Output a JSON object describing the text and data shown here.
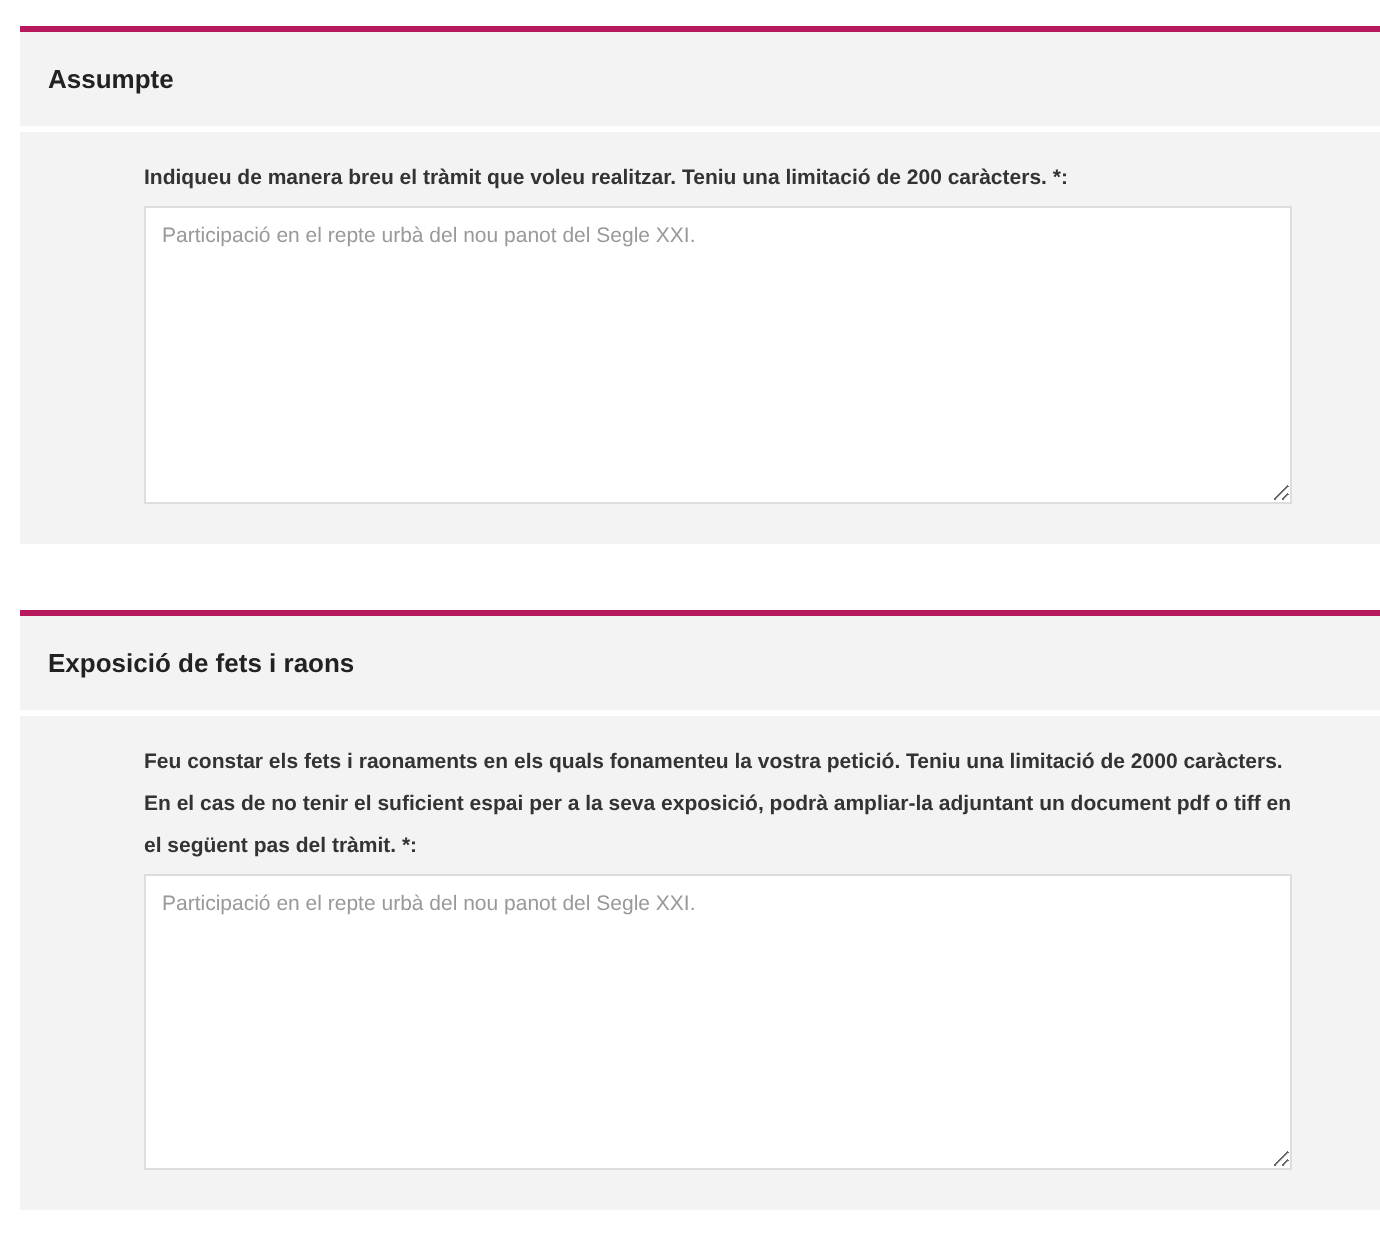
{
  "sections": [
    {
      "title": "Assumpte",
      "label": "Indiqueu de manera breu el tràmit que voleu realitzar. Teniu una limitació de 200 caràcters. *:",
      "placeholder": "Participació en el repte urbà del nou panot del Segle XXI."
    },
    {
      "title": "Exposició de fets i raons",
      "label": "Feu constar els fets i raonaments en els quals fonamenteu la vostra petició. Teniu una limitació de 2000 caràcters. En el cas de no tenir el suficient espai per a la seva exposició, podrà ampliar-la adjuntant un document pdf o tiff en el següent pas del tràmit. *:",
      "placeholder": "Participació en el repte urbà del nou panot del Segle XXI."
    }
  ]
}
